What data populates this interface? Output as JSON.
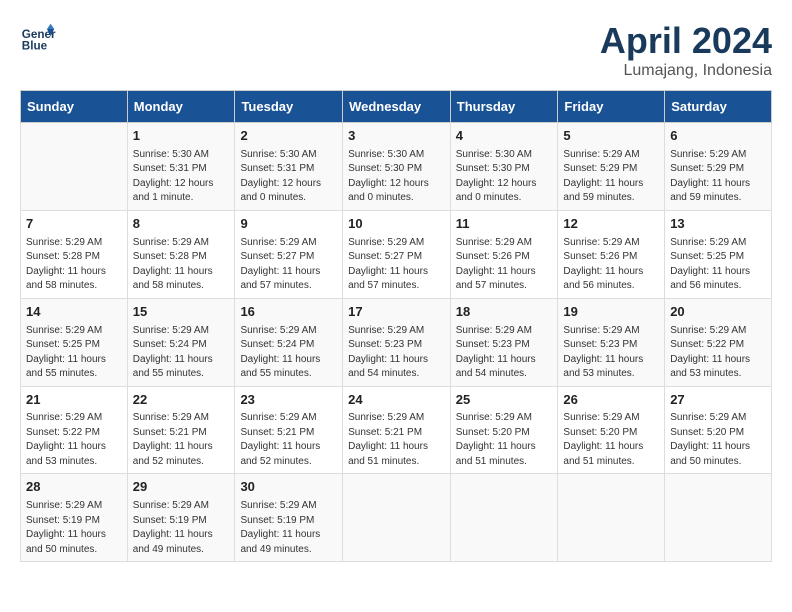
{
  "header": {
    "logo_line1": "General",
    "logo_line2": "Blue",
    "month": "April 2024",
    "location": "Lumajang, Indonesia"
  },
  "weekdays": [
    "Sunday",
    "Monday",
    "Tuesday",
    "Wednesday",
    "Thursday",
    "Friday",
    "Saturday"
  ],
  "weeks": [
    [
      {
        "day": "",
        "info": ""
      },
      {
        "day": "1",
        "info": "Sunrise: 5:30 AM\nSunset: 5:31 PM\nDaylight: 12 hours\nand 1 minute."
      },
      {
        "day": "2",
        "info": "Sunrise: 5:30 AM\nSunset: 5:31 PM\nDaylight: 12 hours\nand 0 minutes."
      },
      {
        "day": "3",
        "info": "Sunrise: 5:30 AM\nSunset: 5:30 PM\nDaylight: 12 hours\nand 0 minutes."
      },
      {
        "day": "4",
        "info": "Sunrise: 5:30 AM\nSunset: 5:30 PM\nDaylight: 12 hours\nand 0 minutes."
      },
      {
        "day": "5",
        "info": "Sunrise: 5:29 AM\nSunset: 5:29 PM\nDaylight: 11 hours\nand 59 minutes."
      },
      {
        "day": "6",
        "info": "Sunrise: 5:29 AM\nSunset: 5:29 PM\nDaylight: 11 hours\nand 59 minutes."
      }
    ],
    [
      {
        "day": "7",
        "info": "Sunrise: 5:29 AM\nSunset: 5:28 PM\nDaylight: 11 hours\nand 58 minutes."
      },
      {
        "day": "8",
        "info": "Sunrise: 5:29 AM\nSunset: 5:28 PM\nDaylight: 11 hours\nand 58 minutes."
      },
      {
        "day": "9",
        "info": "Sunrise: 5:29 AM\nSunset: 5:27 PM\nDaylight: 11 hours\nand 57 minutes."
      },
      {
        "day": "10",
        "info": "Sunrise: 5:29 AM\nSunset: 5:27 PM\nDaylight: 11 hours\nand 57 minutes."
      },
      {
        "day": "11",
        "info": "Sunrise: 5:29 AM\nSunset: 5:26 PM\nDaylight: 11 hours\nand 57 minutes."
      },
      {
        "day": "12",
        "info": "Sunrise: 5:29 AM\nSunset: 5:26 PM\nDaylight: 11 hours\nand 56 minutes."
      },
      {
        "day": "13",
        "info": "Sunrise: 5:29 AM\nSunset: 5:25 PM\nDaylight: 11 hours\nand 56 minutes."
      }
    ],
    [
      {
        "day": "14",
        "info": "Sunrise: 5:29 AM\nSunset: 5:25 PM\nDaylight: 11 hours\nand 55 minutes."
      },
      {
        "day": "15",
        "info": "Sunrise: 5:29 AM\nSunset: 5:24 PM\nDaylight: 11 hours\nand 55 minutes."
      },
      {
        "day": "16",
        "info": "Sunrise: 5:29 AM\nSunset: 5:24 PM\nDaylight: 11 hours\nand 55 minutes."
      },
      {
        "day": "17",
        "info": "Sunrise: 5:29 AM\nSunset: 5:23 PM\nDaylight: 11 hours\nand 54 minutes."
      },
      {
        "day": "18",
        "info": "Sunrise: 5:29 AM\nSunset: 5:23 PM\nDaylight: 11 hours\nand 54 minutes."
      },
      {
        "day": "19",
        "info": "Sunrise: 5:29 AM\nSunset: 5:23 PM\nDaylight: 11 hours\nand 53 minutes."
      },
      {
        "day": "20",
        "info": "Sunrise: 5:29 AM\nSunset: 5:22 PM\nDaylight: 11 hours\nand 53 minutes."
      }
    ],
    [
      {
        "day": "21",
        "info": "Sunrise: 5:29 AM\nSunset: 5:22 PM\nDaylight: 11 hours\nand 53 minutes."
      },
      {
        "day": "22",
        "info": "Sunrise: 5:29 AM\nSunset: 5:21 PM\nDaylight: 11 hours\nand 52 minutes."
      },
      {
        "day": "23",
        "info": "Sunrise: 5:29 AM\nSunset: 5:21 PM\nDaylight: 11 hours\nand 52 minutes."
      },
      {
        "day": "24",
        "info": "Sunrise: 5:29 AM\nSunset: 5:21 PM\nDaylight: 11 hours\nand 51 minutes."
      },
      {
        "day": "25",
        "info": "Sunrise: 5:29 AM\nSunset: 5:20 PM\nDaylight: 11 hours\nand 51 minutes."
      },
      {
        "day": "26",
        "info": "Sunrise: 5:29 AM\nSunset: 5:20 PM\nDaylight: 11 hours\nand 51 minutes."
      },
      {
        "day": "27",
        "info": "Sunrise: 5:29 AM\nSunset: 5:20 PM\nDaylight: 11 hours\nand 50 minutes."
      }
    ],
    [
      {
        "day": "28",
        "info": "Sunrise: 5:29 AM\nSunset: 5:19 PM\nDaylight: 11 hours\nand 50 minutes."
      },
      {
        "day": "29",
        "info": "Sunrise: 5:29 AM\nSunset: 5:19 PM\nDaylight: 11 hours\nand 49 minutes."
      },
      {
        "day": "30",
        "info": "Sunrise: 5:29 AM\nSunset: 5:19 PM\nDaylight: 11 hours\nand 49 minutes."
      },
      {
        "day": "",
        "info": ""
      },
      {
        "day": "",
        "info": ""
      },
      {
        "day": "",
        "info": ""
      },
      {
        "day": "",
        "info": ""
      }
    ]
  ]
}
